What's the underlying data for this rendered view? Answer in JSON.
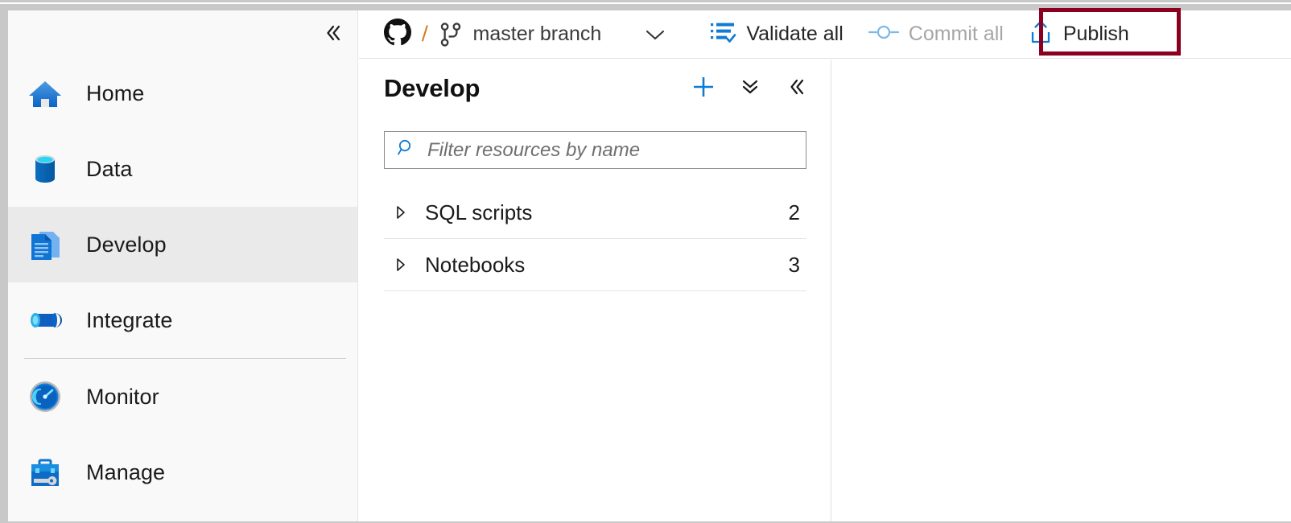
{
  "app": {
    "name": "Azure Synapse Studio",
    "accent_color": "#0078d4",
    "highlight_color": "#8b0021",
    "selected_row_bg": "#eaeaea"
  },
  "sidebar": {
    "collapse_icon": "chevron-double-left-icon",
    "items": [
      {
        "label": "Home",
        "icon": "home-icon",
        "selected": false
      },
      {
        "label": "Data",
        "icon": "database-icon",
        "selected": false
      },
      {
        "label": "Develop",
        "icon": "document-icon",
        "selected": true
      },
      {
        "label": "Integrate",
        "icon": "pipeline-icon",
        "selected": false
      },
      {
        "label": "Monitor",
        "icon": "gauge-icon",
        "selected": false
      },
      {
        "label": "Manage",
        "icon": "toolbox-icon",
        "selected": false
      }
    ]
  },
  "toolbar": {
    "repo_icon": "github-icon",
    "separator": "/",
    "branch_icon": "git-branch-icon",
    "branch_label": "master branch",
    "branch_dropdown_icon": "chevron-down-icon",
    "validate": {
      "label": "Validate all",
      "icon": "validate-all-icon",
      "disabled": false
    },
    "commit": {
      "label": "Commit all",
      "icon": "commit-icon",
      "disabled": true
    },
    "publish": {
      "label": "Publish",
      "icon": "publish-upload-icon",
      "highlighted": true
    }
  },
  "develop_panel": {
    "title": "Develop",
    "actions": [
      {
        "name": "add-new-resource",
        "icon": "plus-icon"
      },
      {
        "name": "collapse-all",
        "icon": "chevron-double-down-icon"
      },
      {
        "name": "collapse-panel",
        "icon": "chevron-double-left-icon"
      }
    ],
    "filter": {
      "icon": "search-icon",
      "value": "",
      "placeholder": "Filter resources by name"
    },
    "tree": [
      {
        "label": "SQL scripts",
        "count": "2",
        "expanded": false,
        "arrow": "triangle-right-icon"
      },
      {
        "label": "Notebooks",
        "count": "3",
        "expanded": false,
        "arrow": "triangle-right-icon"
      }
    ]
  }
}
